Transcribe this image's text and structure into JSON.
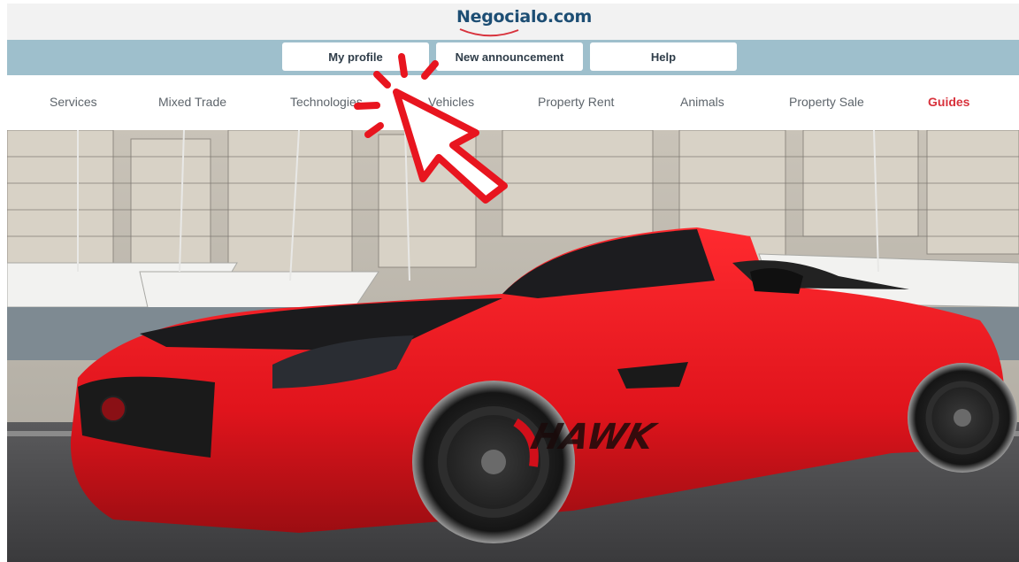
{
  "header": {
    "logo_text": "Negocialo.com"
  },
  "toolbar": {
    "profile_label": "My profile",
    "announcement_label": "New announcement",
    "help_label": "Help"
  },
  "nav": {
    "items": [
      {
        "label": "Services"
      },
      {
        "label": "Mixed Trade"
      },
      {
        "label": "Technologies"
      },
      {
        "label": "Vehicles"
      },
      {
        "label": "Property Rent"
      },
      {
        "label": "Animals"
      },
      {
        "label": "Property Sale"
      },
      {
        "label": "Guides"
      }
    ]
  },
  "hero": {
    "car_decal": "HAWK"
  },
  "colors": {
    "accent": "#d8323c",
    "button_bar": "#9ebfcc",
    "logo": "#1d4e74",
    "car": "#e8151f"
  }
}
